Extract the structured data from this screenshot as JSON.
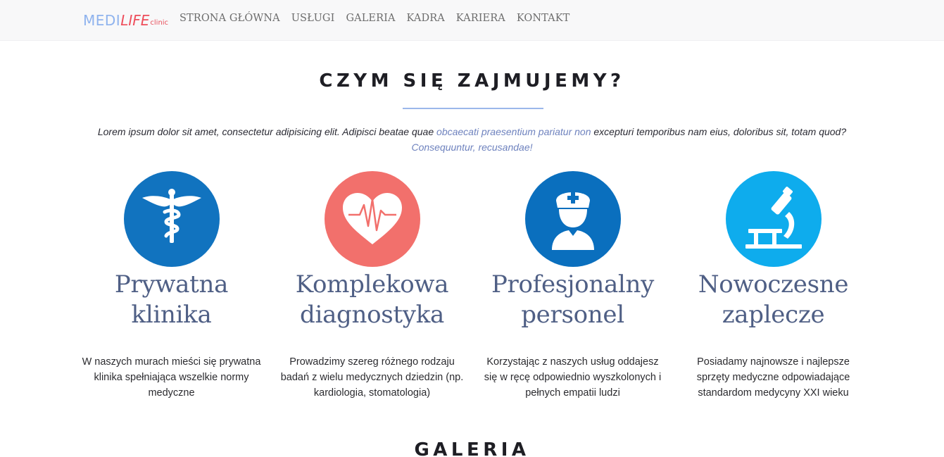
{
  "brand": {
    "medi": "MEDI",
    "life": "LIFE",
    "clinic": "clinic"
  },
  "nav": [
    "STRONA GŁÓWNA",
    "USŁUGI",
    "GALERIA",
    "KADRA",
    "KARIERA",
    "KONTAKT"
  ],
  "section": {
    "title": "CZYM SIĘ ZAJMUJEMY?",
    "intro_part1": "Lorem ipsum dolor sit amet, consectetur adipisicing elit. Adipisci beatae quae ",
    "intro_link1": "obcaecati praesentium pariatur non",
    "intro_part2": " excepturi temporibus nam eius, doloribus sit, totam quod? ",
    "intro_link2": "Consequuntur, recusandae!"
  },
  "features": [
    {
      "icon": "caduceus-icon",
      "color": "#1173bf",
      "title_line1": "Prywatna",
      "title_line2": "klinika",
      "desc": "W naszych murach mieści się prywatna klinika spełniająca wszelkie normy medyczne"
    },
    {
      "icon": "heart-pulse-icon",
      "color": "#f2706c",
      "title_line1": "Komplekowa",
      "title_line2": "diagnostyka",
      "desc": "Prowadzimy szereg różnego rodzaju badań z wielu medycznych dziedzin (np. kardiologia, stomatologia)"
    },
    {
      "icon": "nurse-icon",
      "color": "#0a6fbe",
      "title_line1": "Profesjonalny",
      "title_line2": "personel",
      "desc": "Korzystając z naszych usług oddajesz się w ręcę odpowiednio wyszkolonych i pełnych empatii ludzi"
    },
    {
      "icon": "microscope-icon",
      "color": "#0eaced",
      "title_line1": "Nowoczesne",
      "title_line2": "zaplecze",
      "desc": "Posiadamy najnowsze i najlepsze sprzęty medyczne odpowiadające standardom medycyny XXI wieku"
    }
  ],
  "gallery": {
    "title": "GALERIA"
  }
}
